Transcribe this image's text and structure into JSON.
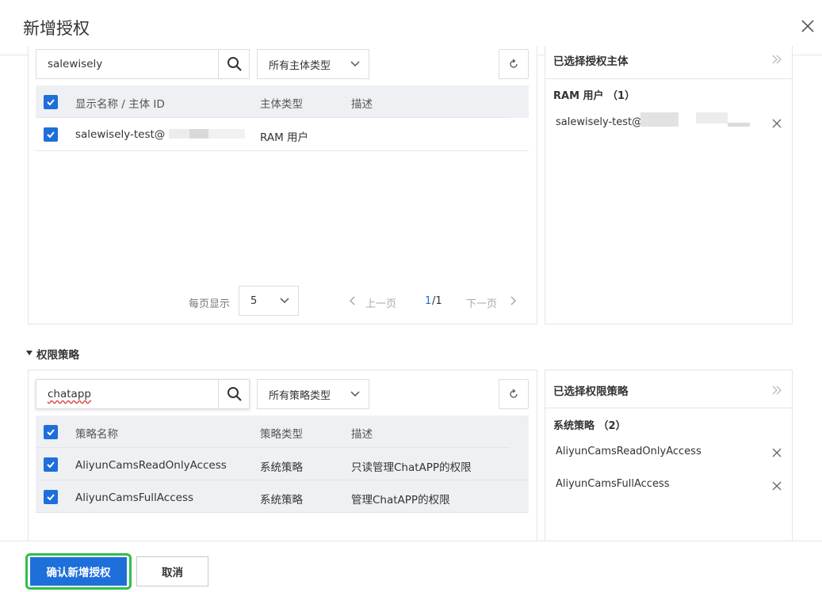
{
  "dialog": {
    "title": "新增授权",
    "close_icon": "close-icon"
  },
  "principal_section": {
    "search_value": "salewisely",
    "type_select": "所有主体类型",
    "table": {
      "columns": [
        "显示名称 / 主体 ID",
        "主体类型",
        "描述"
      ],
      "rows": [
        {
          "name": "salewisely-test@",
          "type": "RAM 用户",
          "desc": "",
          "checked": true
        }
      ]
    },
    "pagination": {
      "page_size_label": "每页显示",
      "page_size": "5",
      "prev": "上一页",
      "current": "1",
      "total": "/1",
      "next": "下一页"
    },
    "selected": {
      "title": "已选择授权主体",
      "group": "RAM 用户 （1）",
      "items": [
        "salewisely-test@"
      ]
    }
  },
  "policy_section": {
    "heading": "权限策略",
    "search_value": "chatapp",
    "type_select": "所有策略类型",
    "table": {
      "columns": [
        "策略名称",
        "策略类型",
        "描述"
      ],
      "rows": [
        {
          "name": "AliyunCamsReadOnlyAccess",
          "type": "系统策略",
          "desc": "只读管理ChatAPP的权限",
          "checked": true
        },
        {
          "name": "AliyunCamsFullAccess",
          "type": "系统策略",
          "desc": "管理ChatAPP的权限",
          "checked": true
        }
      ]
    },
    "selected": {
      "title": "已选择权限策略",
      "group": "系统策略 （2）",
      "items": [
        "AliyunCamsReadOnlyAccess",
        "AliyunCamsFullAccess"
      ]
    }
  },
  "footer": {
    "confirm": "确认新增授权",
    "cancel": "取消"
  },
  "colors": {
    "primary": "#1e6fd9",
    "highlight": "#2fbf4a"
  }
}
